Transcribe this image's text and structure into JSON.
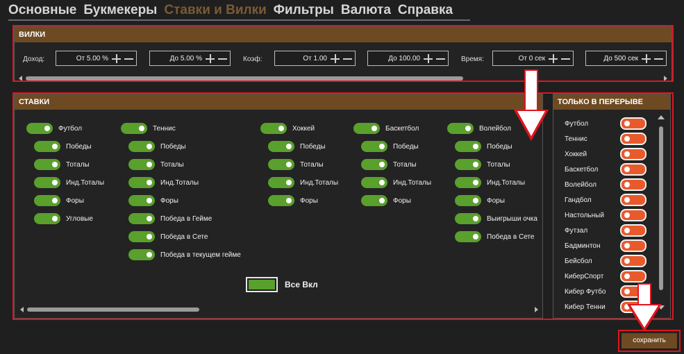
{
  "tabs": [
    "Основные",
    "Букмекеры",
    "Ставки и Вилки",
    "Фильтры",
    "Валюта",
    "Справка"
  ],
  "active_tab_index": 2,
  "forks": {
    "title": "ВИЛКИ",
    "income_label": "Доход:",
    "income_from": "От 5.00 %",
    "income_to": "До 5.00 %",
    "coef_label": "Коэф:",
    "coef_from": "От 1.00",
    "coef_to": "До 100.00",
    "time_label": "Время:",
    "time_from": "От 0 сек",
    "time_to": "До 500 сек"
  },
  "bets": {
    "title": "СТАВКИ",
    "columns": [
      {
        "sport": "Футбол",
        "items": [
          "Победы",
          "Тоталы",
          "Инд.Тоталы",
          "Форы",
          "Угловые"
        ]
      },
      {
        "sport": "Теннис",
        "items": [
          "Победы",
          "Тоталы",
          "Инд.Тоталы",
          "Форы",
          "Победа в Гейме",
          "Победа в Сете",
          "Победа в текущем гейме"
        ]
      },
      {
        "sport": "Хоккей",
        "items": [
          "Победы",
          "Тоталы",
          "Инд.Тоталы",
          "Форы"
        ]
      },
      {
        "sport": "Баскетбол",
        "items": [
          "Победы",
          "Тоталы",
          "Инд.Тоталы",
          "Форы"
        ]
      },
      {
        "sport": "Волейбол",
        "items": [
          "Победы",
          "Тоталы",
          "Инд.Тоталы",
          "Форы",
          "Выигрыши очка",
          "Победа в Сете"
        ]
      }
    ],
    "all_on_label": "Все Вкл"
  },
  "breaks": {
    "title": "ТОЛЬКО В ПЕРЕРЫВЕ",
    "items": [
      "Футбол",
      "Теннис",
      "Хоккей",
      "Баскетбол",
      "Волейбол",
      "Гандбол",
      "Настольный",
      "Футзал",
      "Бадминтон",
      "Бейсбол",
      "КиберСпорт",
      "Кибер Футбо",
      "Кибер Тенни"
    ]
  },
  "save_label": "сохранить",
  "colors": {
    "accent": "#6e4a22",
    "on": "#5aa02c",
    "off": "#e85a2c",
    "highlight": "#e0141e"
  }
}
